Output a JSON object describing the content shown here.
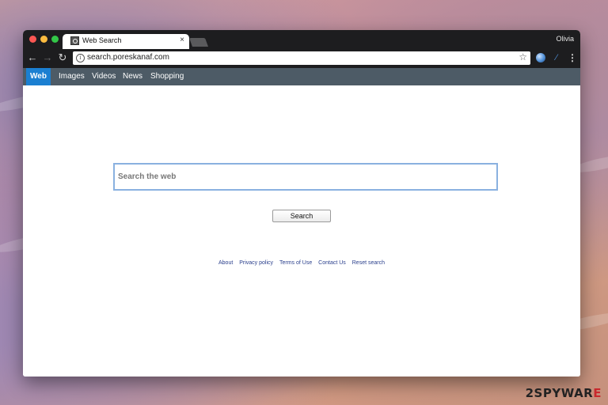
{
  "browser": {
    "tab_title": "Web Search",
    "tab_close": "×",
    "profile_name": "Olivia",
    "url": "search.poreskanaf.com",
    "icons": {
      "back": "arrow-left-icon",
      "forward": "arrow-right-icon",
      "reload": "reload-icon",
      "info": "info-icon",
      "bookmark": "star-icon",
      "extension_1": "globe-icon",
      "extension_2": "extension-icon",
      "menu": "more-vertical-icon"
    },
    "glyphs": {
      "back": "←",
      "forward": "→",
      "reload": "↻",
      "info": "i",
      "star": "☆",
      "ext2": "⁄",
      "menu": "⋮"
    },
    "traffic_lights": {
      "close": "#fc5753",
      "minimize": "#fdbc40",
      "maximize": "#33c748"
    }
  },
  "search_nav": {
    "items": [
      {
        "label": "Web",
        "active": true
      },
      {
        "label": "Images",
        "active": false
      },
      {
        "label": "Videos",
        "active": false
      },
      {
        "label": "News",
        "active": false
      },
      {
        "label": "Shopping",
        "active": false
      }
    ]
  },
  "search": {
    "placeholder": "Search the web",
    "button_label": "Search"
  },
  "footer": {
    "links": [
      "About",
      "Privacy policy",
      "Terms of Use",
      "Contact Us",
      "Reset search"
    ]
  },
  "watermark": {
    "text_dark": "2SPYWAR",
    "text_red": "E"
  },
  "colors": {
    "nav_bar": "#4d5b66",
    "nav_active": "#1b7fd1",
    "link": "#2a3f8c",
    "search_border": "#8ab1e0"
  }
}
